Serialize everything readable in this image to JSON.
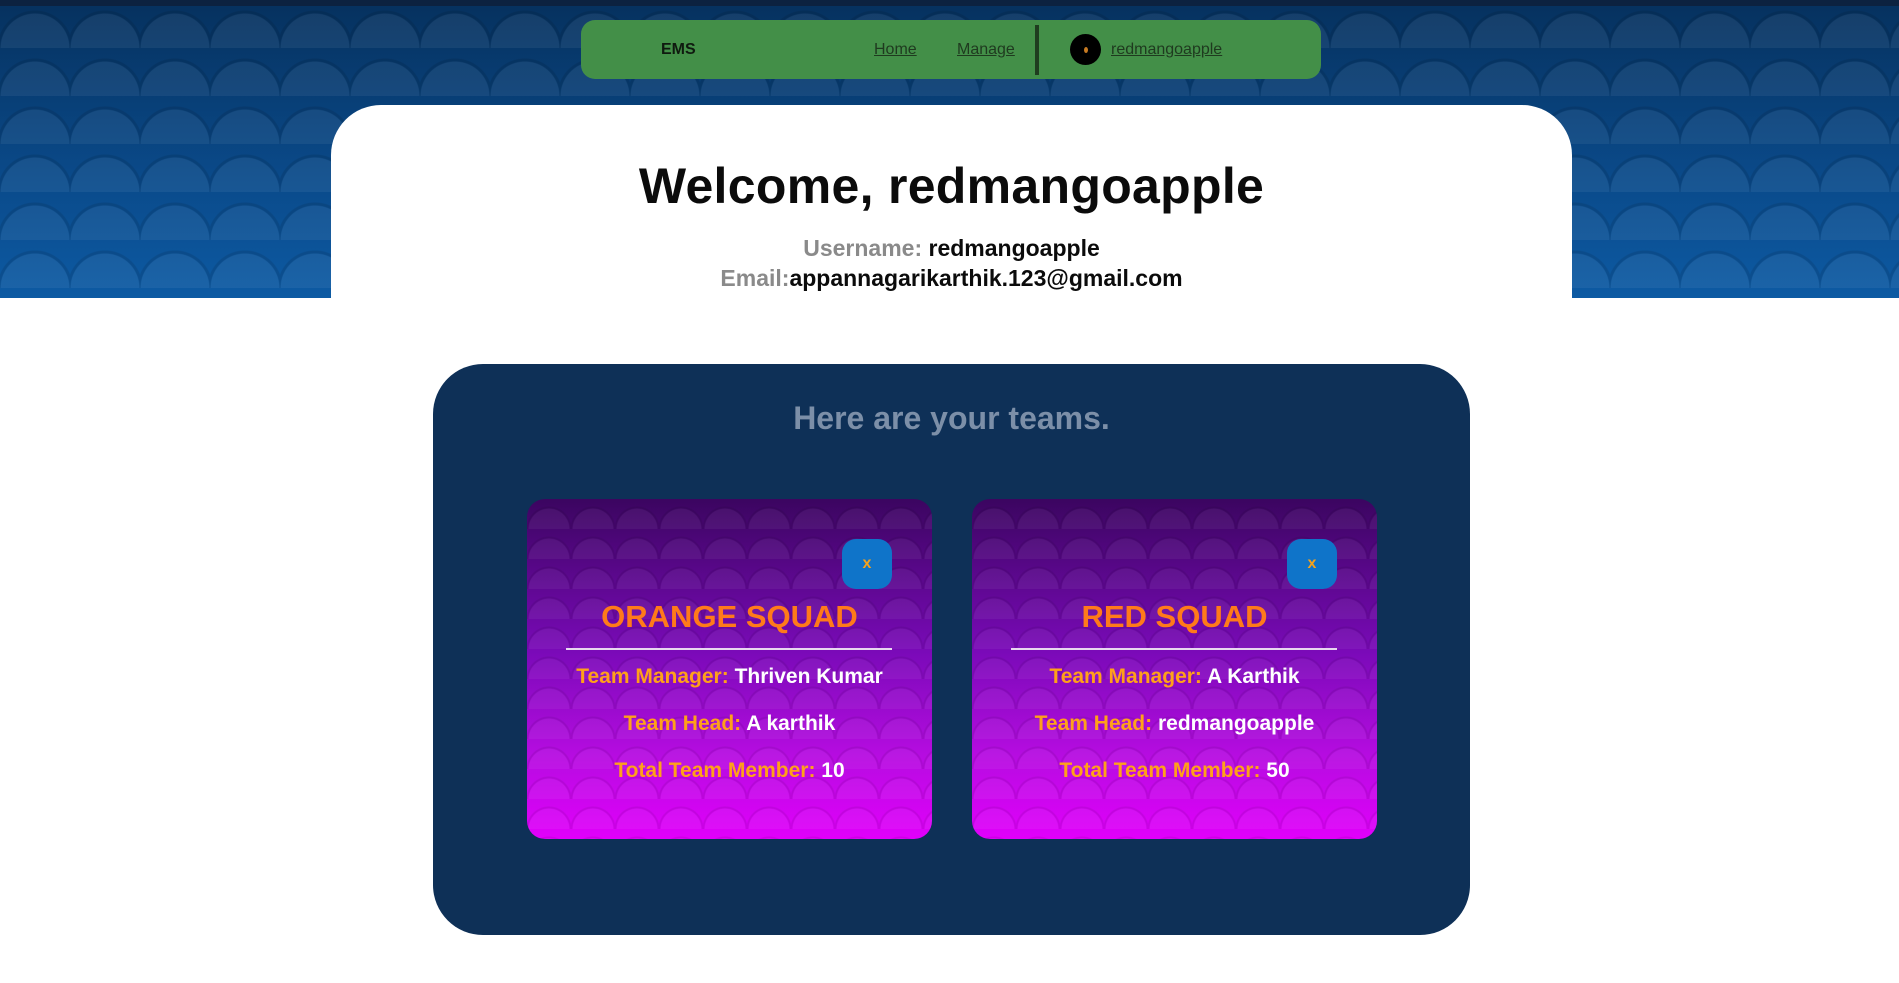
{
  "navbar": {
    "brand": "EMS",
    "links": [
      "Home",
      "Manage"
    ],
    "username": "redmangoapple"
  },
  "welcome": {
    "title": "Welcome, redmangoapple",
    "username_label": "Username:",
    "username_value": "redmangoapple",
    "email_label": "Email:",
    "email_value": "appannagarikarthik.123@gmail.com"
  },
  "teams": {
    "heading": "Here are your teams.",
    "close_label": "x",
    "manager_label": "Team Manager:",
    "head_label": "Team Head:",
    "members_label": "Total Team Member:",
    "items": [
      {
        "name": "ORANGE SQUAD",
        "manager": "Thriven Kumar",
        "head": "A karthik",
        "members": "10"
      },
      {
        "name": "RED SQUAD",
        "manager": "A Karthik",
        "head": "redmangoapple",
        "members": "50"
      }
    ]
  },
  "colors": {
    "navbar_bg": "#438f48",
    "panel_bg": "#0e3057",
    "team_name": "#ff7a1a",
    "label_orange": "#ffa01a",
    "close_button": "#0f74c9"
  }
}
